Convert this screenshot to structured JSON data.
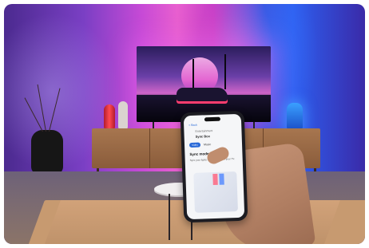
{
  "scene": {
    "description_tags": [
      "living-room",
      "ambilight-tv",
      "smartphone-app",
      "synthwave-tv-content"
    ],
    "palette": {
      "wall_left": "#7a3fc4",
      "wall_center": "#e85fcf",
      "wall_right": "#2d5ff0",
      "cabinet": "#a7764f",
      "rug": "#c79a70",
      "accent_app": "#2a6ad8"
    }
  },
  "phone_screen": {
    "top_link": "< Back",
    "subtitle": "Entertainment",
    "device_name": "Sync Box",
    "tabs": [
      "Video",
      "Music"
    ],
    "section_title": "Sync mode",
    "body_text": "Sync your lights to the content on your TV."
  }
}
